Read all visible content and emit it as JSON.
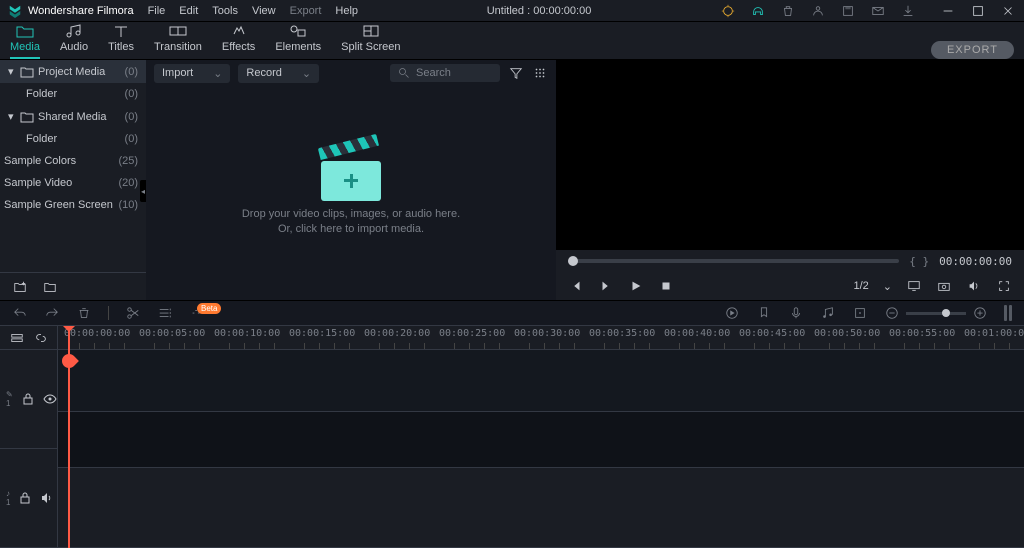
{
  "app": {
    "name": "Wondershare Filmora",
    "title": "Untitled : 00:00:00:00"
  },
  "menu": {
    "file": "File",
    "edit": "Edit",
    "tools": "Tools",
    "view": "View",
    "export": "Export",
    "help": "Help"
  },
  "tabs": {
    "media": "Media",
    "audio": "Audio",
    "titles": "Titles",
    "transition": "Transition",
    "effects": "Effects",
    "elements": "Elements",
    "split": "Split Screen"
  },
  "export_btn": "EXPORT",
  "sidebar": {
    "items": [
      {
        "label": "Project Media",
        "count": "(0)",
        "folder": true,
        "caret": true,
        "sel": true
      },
      {
        "label": "Folder",
        "count": "(0)",
        "child": true
      },
      {
        "label": "Shared Media",
        "count": "(0)",
        "folder": true,
        "caret": true
      },
      {
        "label": "Folder",
        "count": "(0)",
        "child": true
      },
      {
        "label": "Sample Colors",
        "count": "(25)",
        "top": true
      },
      {
        "label": "Sample Video",
        "count": "(20)",
        "top": true
      },
      {
        "label": "Sample Green Screen",
        "count": "(10)",
        "top": true
      }
    ]
  },
  "media_bar": {
    "import": "Import",
    "record": "Record",
    "search": "Search"
  },
  "drop": {
    "line1": "Drop your video clips, images, or audio here.",
    "line2": "Or, click here to import media."
  },
  "preview": {
    "markers": "{        }",
    "time": "00:00:00:00",
    "ratio": "1/2"
  },
  "timeline": {
    "beta": "Beta",
    "ticks": [
      "00:00:00:00",
      "00:00:05:00",
      "00:00:10:00",
      "00:00:15:00",
      "00:00:20:00",
      "00:00:25:00",
      "00:00:30:00",
      "00:00:35:00",
      "00:00:40:00",
      "00:00:45:00",
      "00:00:50:00",
      "00:00:55:00",
      "00:01:00:00"
    ],
    "tracks": {
      "video": "✎ 1",
      "audio": "♪ 1"
    }
  }
}
